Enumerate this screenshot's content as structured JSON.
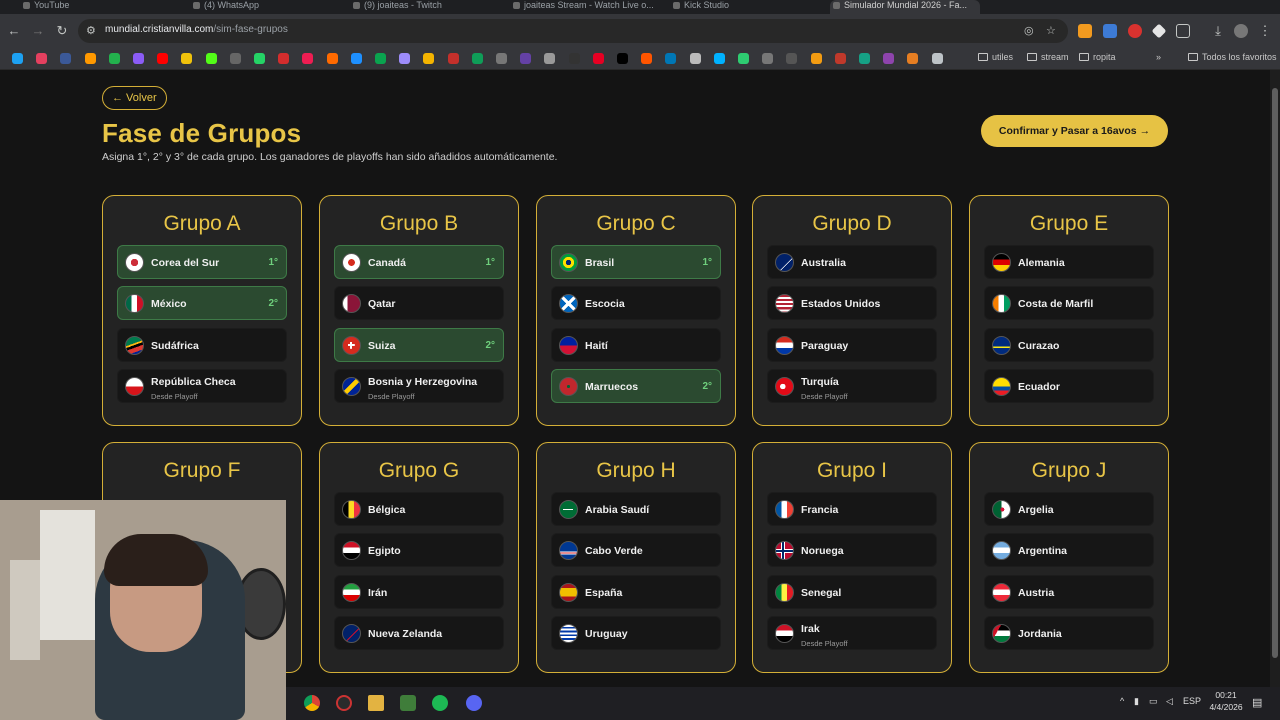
{
  "browser": {
    "tabs": [
      {
        "label": "YouTube",
        "active": false
      },
      {
        "label": "(4) WhatsApp",
        "active": false
      },
      {
        "label": "(9) joaiteas - Twitch",
        "active": false
      },
      {
        "label": "joaiteas Stream - Watch Live o...",
        "active": false
      },
      {
        "label": "Kick Studio",
        "active": false
      },
      {
        "label": "Simulador Mundial 2026 - Fa...",
        "active": true
      }
    ],
    "url_host": "mundial.cristianvilla.com",
    "url_path": "/sim-fase-grupos",
    "bookmark_folders": [
      "utiles",
      "stream",
      "ropita"
    ],
    "all_bookmarks_label": "Todos los favoritos"
  },
  "page": {
    "back_label": "← Volver",
    "title": "Fase de Grupos",
    "subtitle": "Asigna 1°, 2° y 3° de cada grupo. Los ganadores de playoffs han sido añadidos automáticamente.",
    "confirm_label": "Confirmar y Pasar a 16avos →"
  },
  "groups": [
    {
      "title": "Grupo A",
      "teams": [
        {
          "name": "Corea del Sur",
          "flag": "korea",
          "pos": "1°",
          "sub": ""
        },
        {
          "name": "México",
          "flag": "mexico",
          "pos": "2°",
          "sub": ""
        },
        {
          "name": "Sudáfrica",
          "flag": "southafrica",
          "pos": "",
          "sub": ""
        },
        {
          "name": "República Checa",
          "flag": "czech",
          "pos": "",
          "sub": "Desde Playoff"
        }
      ]
    },
    {
      "title": "Grupo B",
      "teams": [
        {
          "name": "Canadá",
          "flag": "canada",
          "pos": "1°",
          "sub": ""
        },
        {
          "name": "Qatar",
          "flag": "qatar",
          "pos": "",
          "sub": ""
        },
        {
          "name": "Suiza",
          "flag": "switzerland",
          "pos": "2°",
          "sub": ""
        },
        {
          "name": "Bosnia y Herzegovina",
          "flag": "bosnia",
          "pos": "",
          "sub": "Desde Playoff"
        }
      ]
    },
    {
      "title": "Grupo C",
      "teams": [
        {
          "name": "Brasil",
          "flag": "brazil",
          "pos": "1°",
          "sub": ""
        },
        {
          "name": "Escocia",
          "flag": "scotland",
          "pos": "",
          "sub": ""
        },
        {
          "name": "Haití",
          "flag": "haiti",
          "pos": "",
          "sub": ""
        },
        {
          "name": "Marruecos",
          "flag": "morocco",
          "pos": "2°",
          "sub": ""
        }
      ]
    },
    {
      "title": "Grupo D",
      "teams": [
        {
          "name": "Australia",
          "flag": "australia",
          "pos": "",
          "sub": ""
        },
        {
          "name": "Estados Unidos",
          "flag": "usa",
          "pos": "",
          "sub": ""
        },
        {
          "name": "Paraguay",
          "flag": "paraguay",
          "pos": "",
          "sub": ""
        },
        {
          "name": "Turquía",
          "flag": "turkey",
          "pos": "",
          "sub": "Desde Playoff"
        }
      ]
    },
    {
      "title": "Grupo E",
      "teams": [
        {
          "name": "Alemania",
          "flag": "germany",
          "pos": "",
          "sub": ""
        },
        {
          "name": "Costa de Marfil",
          "flag": "ivorycoast",
          "pos": "",
          "sub": ""
        },
        {
          "name": "Curazao",
          "flag": "curacao",
          "pos": "",
          "sub": ""
        },
        {
          "name": "Ecuador",
          "flag": "ecuador",
          "pos": "",
          "sub": ""
        }
      ]
    },
    {
      "title": "Grupo F",
      "teams": []
    },
    {
      "title": "Grupo G",
      "teams": [
        {
          "name": "Bélgica",
          "flag": "belgium",
          "pos": "",
          "sub": ""
        },
        {
          "name": "Egipto",
          "flag": "egypt",
          "pos": "",
          "sub": ""
        },
        {
          "name": "Irán",
          "flag": "iran",
          "pos": "",
          "sub": ""
        },
        {
          "name": "Nueva Zelanda",
          "flag": "newzealand",
          "pos": "",
          "sub": ""
        }
      ]
    },
    {
      "title": "Grupo H",
      "teams": [
        {
          "name": "Arabia Saudí",
          "flag": "saudi",
          "pos": "",
          "sub": ""
        },
        {
          "name": "Cabo Verde",
          "flag": "capeverde",
          "pos": "",
          "sub": ""
        },
        {
          "name": "España",
          "flag": "spain",
          "pos": "",
          "sub": ""
        },
        {
          "name": "Uruguay",
          "flag": "uruguay",
          "pos": "",
          "sub": ""
        }
      ]
    },
    {
      "title": "Grupo I",
      "teams": [
        {
          "name": "Francia",
          "flag": "france",
          "pos": "",
          "sub": ""
        },
        {
          "name": "Noruega",
          "flag": "norway",
          "pos": "",
          "sub": ""
        },
        {
          "name": "Senegal",
          "flag": "senegal",
          "pos": "",
          "sub": ""
        },
        {
          "name": "Irak",
          "flag": "iraq",
          "pos": "",
          "sub": "Desde Playoff"
        }
      ]
    },
    {
      "title": "Grupo J",
      "teams": [
        {
          "name": "Argelia",
          "flag": "algeria",
          "pos": "",
          "sub": ""
        },
        {
          "name": "Argentina",
          "flag": "argentina",
          "pos": "",
          "sub": ""
        },
        {
          "name": "Austria",
          "flag": "austria",
          "pos": "",
          "sub": ""
        },
        {
          "name": "Jordania",
          "flag": "jordan",
          "pos": "",
          "sub": ""
        }
      ]
    }
  ],
  "taskbar": {
    "language": "ESP",
    "time": "00:21",
    "date": "4/4/2026"
  },
  "colors": {
    "accent_gold": "#e8c547",
    "qualified_green": "#2b4a30",
    "background": "#141414"
  }
}
